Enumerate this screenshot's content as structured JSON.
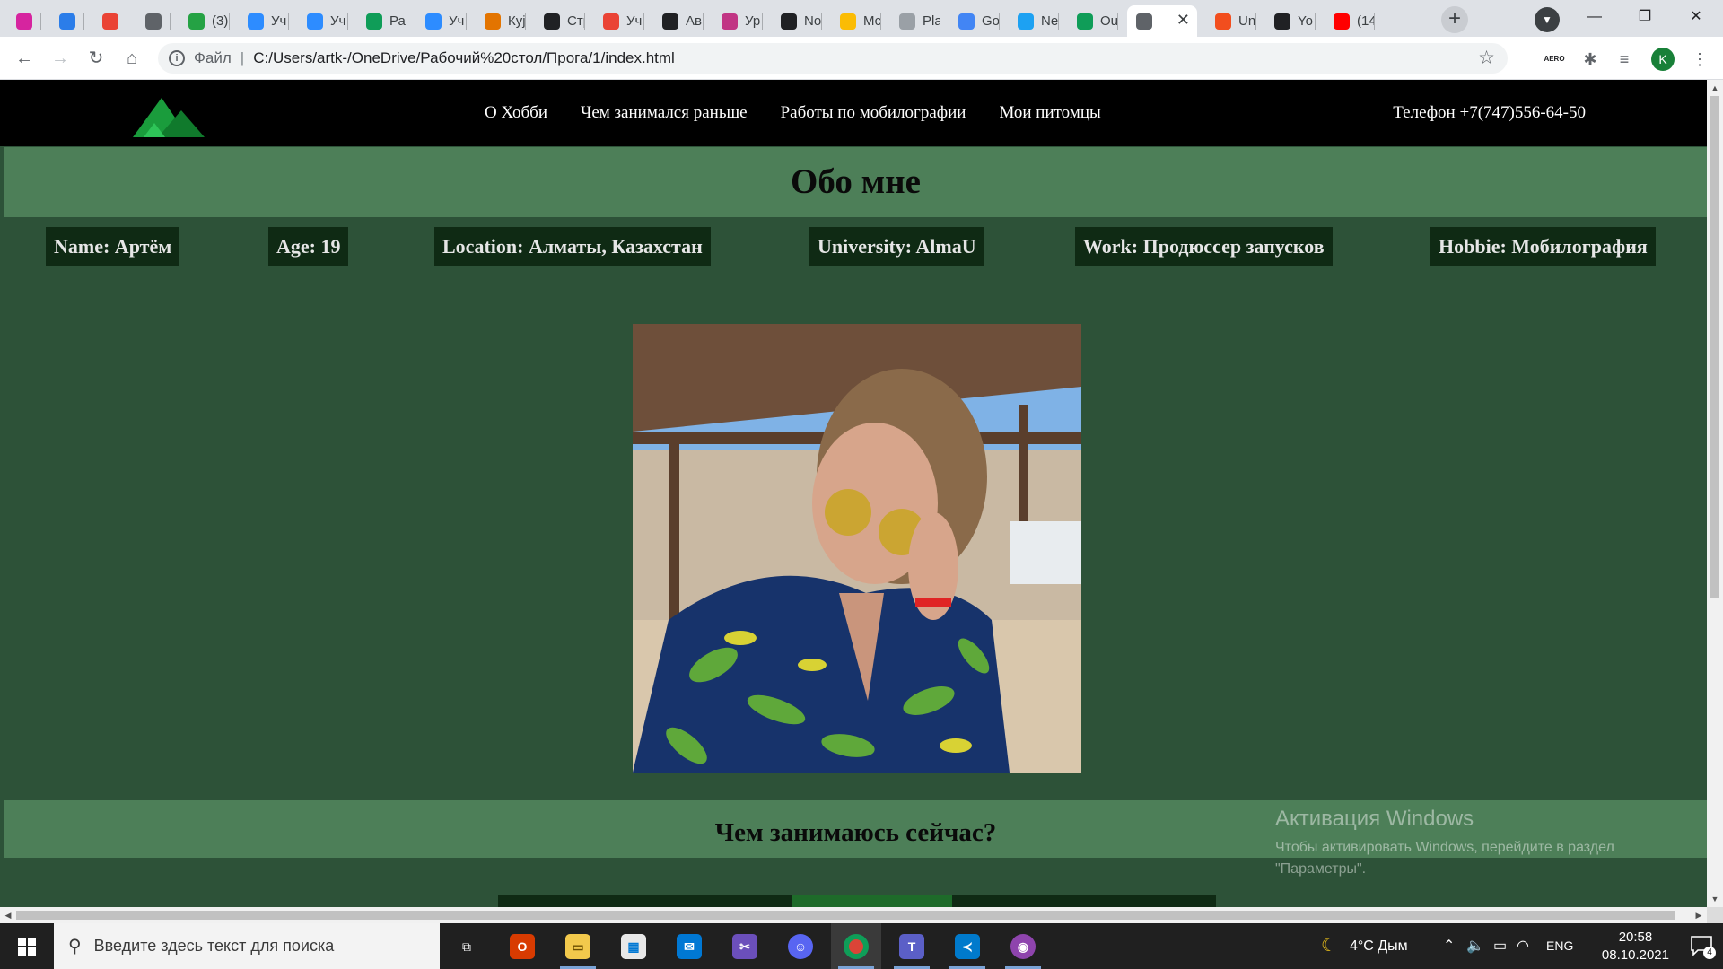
{
  "browser": {
    "tabs": [
      {
        "label": "",
        "color": "#d6249f"
      },
      {
        "label": "",
        "color": "#2b7de9"
      },
      {
        "label": "",
        "color": "#ea4335"
      },
      {
        "label": "",
        "color": "#5f6368"
      },
      {
        "label": "(3)",
        "color": "#25a244"
      },
      {
        "label": "Уч",
        "color": "#2d8cff"
      },
      {
        "label": "Уч",
        "color": "#2d8cff"
      },
      {
        "label": "Ра",
        "color": "#0f9d58"
      },
      {
        "label": "Уч",
        "color": "#2d8cff"
      },
      {
        "label": "Куј",
        "color": "#e37400"
      },
      {
        "label": "Стр",
        "color": "#202124"
      },
      {
        "label": "Уч",
        "color": "#ea4335"
      },
      {
        "label": "Ав",
        "color": "#202124"
      },
      {
        "label": "Ур",
        "color": "#c13584"
      },
      {
        "label": "No",
        "color": "#202124"
      },
      {
        "label": "Мс",
        "color": "#fbbc04"
      },
      {
        "label": "Pla",
        "color": "#9aa0a6"
      },
      {
        "label": "Go",
        "color": "#4285f4"
      },
      {
        "label": "Ne",
        "color": "#1da1f2"
      },
      {
        "label": "Ou",
        "color": "#0f9d58"
      },
      {
        "label": "",
        "color": "#5f6368",
        "active": true
      },
      {
        "label": "Un",
        "color": "#f24e1e"
      },
      {
        "label": "Yo",
        "color": "#202124"
      },
      {
        "label": "(14",
        "color": "#ff0000"
      }
    ],
    "address": {
      "scheme_label": "Файл",
      "url": "C:/Users/artk-/OneDrive/Рабочий%20стол/Прога/1/index.html"
    },
    "profile_initial": "K",
    "aero_label": "AERO"
  },
  "site": {
    "nav": [
      "О Хобби",
      "Чем занимался раньше",
      "Работы по мобилографии",
      "Мои питомцы"
    ],
    "phone": "Телефон +7(747)556-64-50",
    "about_title": "Обо мне",
    "info": [
      "Name: Артём",
      "Age: 19",
      "Location: Алматы, Казахстан",
      "University: AlmaU",
      "Work: Продюссер запусков",
      "Hobbie: Мобилография"
    ],
    "doing_title": "Чем занимаюсь сейчас?"
  },
  "watermark": {
    "title": "Активация Windows",
    "text": "Чтобы активировать Windows, перейдите в раздел \"Параметры\"."
  },
  "taskbar": {
    "search_placeholder": "Введите здесь текст для поиска",
    "weather": "4°C Дым",
    "language": "ENG",
    "time": "20:58",
    "date": "08.10.2021",
    "notifications": "4"
  }
}
